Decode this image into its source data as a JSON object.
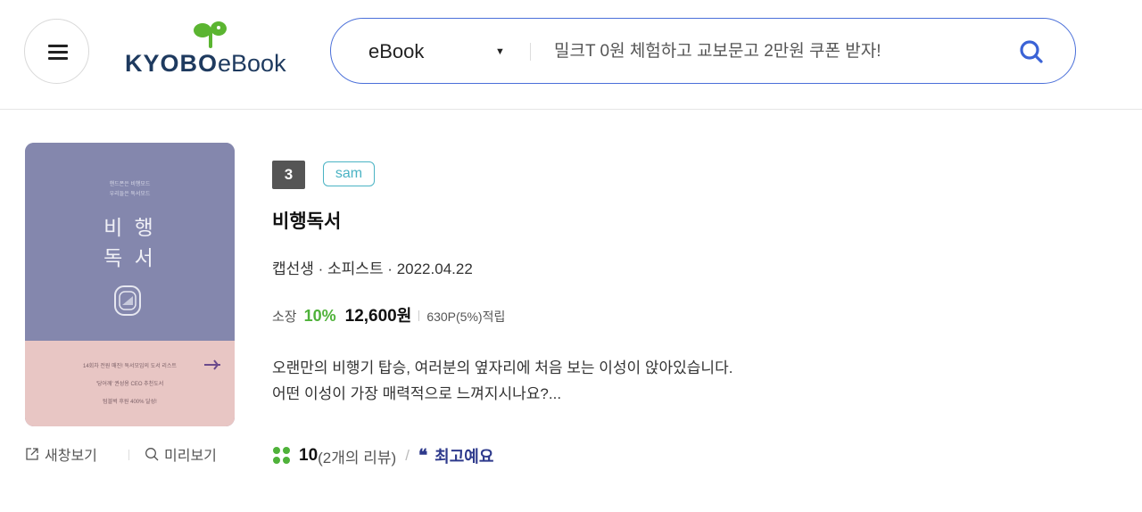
{
  "header": {
    "logo_main": "KYOBO",
    "logo_sub": "eBook",
    "search": {
      "category": "eBook",
      "placeholder": "밀크T 0원 체험하고 교보문고 2만원 쿠폰 받자!"
    }
  },
  "product": {
    "rank": "3",
    "badge": "sam",
    "title": "비행독서",
    "meta": "캡선생 · 소피스트 · 2022.04.22",
    "price": {
      "type": "소장",
      "discount": "10%",
      "amount": "12,600",
      "unit": "원",
      "points": "630P(5%)적립"
    },
    "description": [
      "오랜만의 비행기 탑승, 여러분의 옆자리에 처음 보는 이성이 앉아있습니다.",
      "어떤 이성이 가장 매력적으로 느껴지시나요?..."
    ],
    "review": {
      "score": "10",
      "count": "(2개의 리뷰)",
      "separator": "/",
      "quote_glyph": "❝",
      "tag": "최고예요"
    },
    "cover": {
      "sub_line1": "핸드폰은 비행모드",
      "sub_line2": "우리들은 독서모드",
      "title_line1": "비 행",
      "title_line2": "독 서",
      "blurb_line1": "14회차 전원 매진! 독서모임의 도서 리스트",
      "blurb_line2": "'당어깨' 권성용 CEO 추천도서",
      "blurb_line3": "텀블벅 후원 400% 달성!"
    },
    "actions": {
      "new_window": "새창보기",
      "preview": "미리보기"
    }
  },
  "colors": {
    "search_border": "#4a6fd9",
    "discount": "#4fb23a",
    "sam_badge": "#4ab3c4",
    "review_tag": "#2e3a8c",
    "logo_leaf": "#5bb531",
    "logo_text": "#1e3a5f"
  },
  "icons": {
    "menu": "hamburger-icon",
    "search": "search-icon",
    "new_window": "external-link-icon",
    "preview": "magnifier-icon",
    "klover": "klover-icon",
    "quote": "quote-icon"
  }
}
